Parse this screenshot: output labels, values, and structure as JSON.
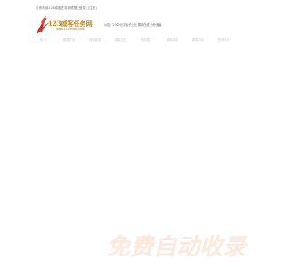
{
  "header": {
    "top_links": "可悲利用123威客任务网联盟 [登录] [注册]",
    "logo_name": "123威客任务网",
    "logo_url": "www.123renwu.com",
    "notice": "公告：2000元平板子上元 展现在线 分外速遍"
  },
  "nav": {
    "items": [
      "首 页",
      "威客任务",
      "网站建设",
      "威客文档",
      "网络推广",
      "威客动态",
      "威客论坛",
      "任务大厅"
    ]
  },
  "watermark": {
    "text": "免费自动收录"
  },
  "colors": {
    "logo_gold": "#c8891b",
    "logo_red": "#c0262b",
    "nav_text": "#c9c9c9",
    "watermark": "#fde8dc"
  }
}
